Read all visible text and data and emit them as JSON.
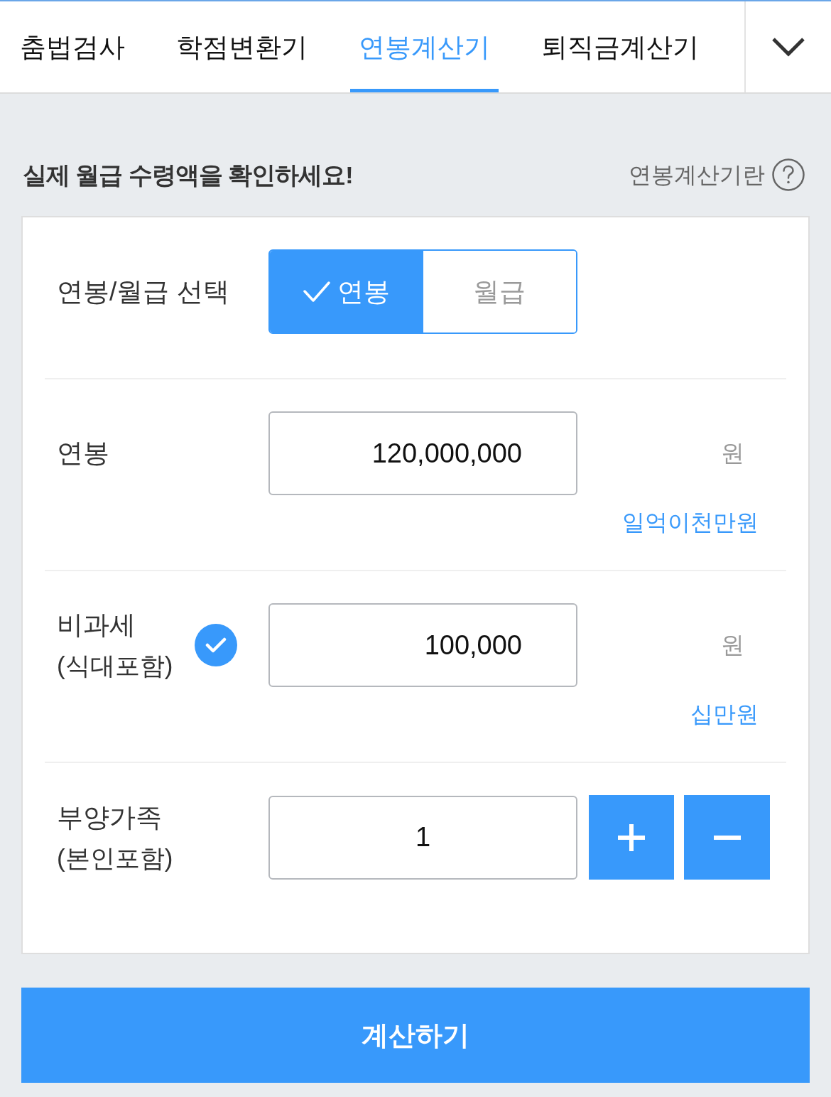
{
  "tabs": [
    {
      "label": "춤법검사",
      "selected": false
    },
    {
      "label": "학점변환기",
      "selected": false
    },
    {
      "label": "연봉계산기",
      "selected": true
    },
    {
      "label": "퇴직금계산기",
      "selected": false
    }
  ],
  "heading": "실제 월급 수령액을 확인하세요!",
  "help_link": "연봉계산기란",
  "rows": [
    {
      "kind": "choice",
      "label": "연봉/월급 선택",
      "options": [
        {
          "label": "연봉",
          "selected": true
        },
        {
          "label": "월급",
          "selected": false
        }
      ]
    },
    {
      "kind": "amount",
      "label": "연봉",
      "value": "120,000,000",
      "unit": "원",
      "in_words": "일억이천만원"
    },
    {
      "kind": "amount",
      "label": "비과세",
      "sublabel": "(식대포함)",
      "checked": true,
      "value": "100,000",
      "unit": "원",
      "in_words": "십만원"
    },
    {
      "kind": "counter",
      "label": "부양가족",
      "sublabel": "(본인포함)",
      "value": "1"
    }
  ],
  "submit_button": "계산하기"
}
